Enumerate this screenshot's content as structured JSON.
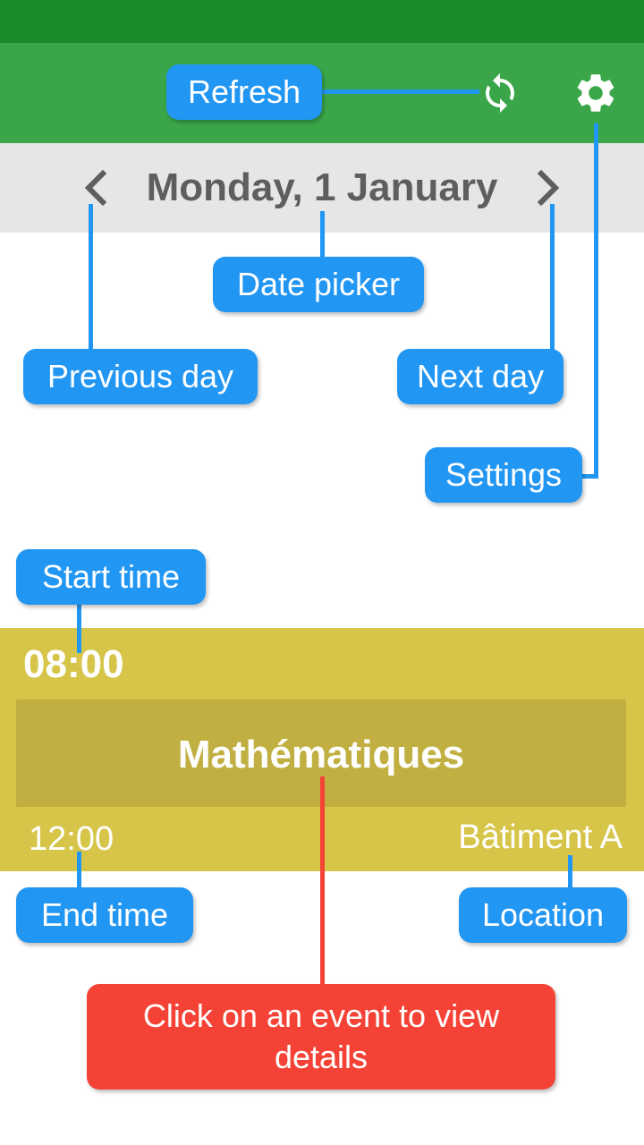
{
  "toolbar": {
    "refresh_icon": "refresh-icon",
    "settings_icon": "gear-icon"
  },
  "date_nav": {
    "date": "Monday, 1 January",
    "prev_icon": "chevron-left-icon",
    "next_icon": "chevron-right-icon"
  },
  "event": {
    "start": "08:00",
    "title": "Mathématiques",
    "end": "12:00",
    "location": "Bâtiment A"
  },
  "tips": {
    "refresh": "Refresh",
    "date_picker": "Date picker",
    "previous_day": "Previous day",
    "next_day": "Next day",
    "settings": "Settings",
    "start_time": "Start time",
    "end_time": "End time",
    "location": "Location",
    "event_hint": "Click on an event to view details"
  },
  "colors": {
    "status_bar": "#1b8a2a",
    "app_bar": "#3aa649",
    "date_bar": "#e6e6e6",
    "event": "#d6c549",
    "event_title_bg": "#c1b041",
    "tip": "#2196f3",
    "tip_alert": "#f44336"
  }
}
